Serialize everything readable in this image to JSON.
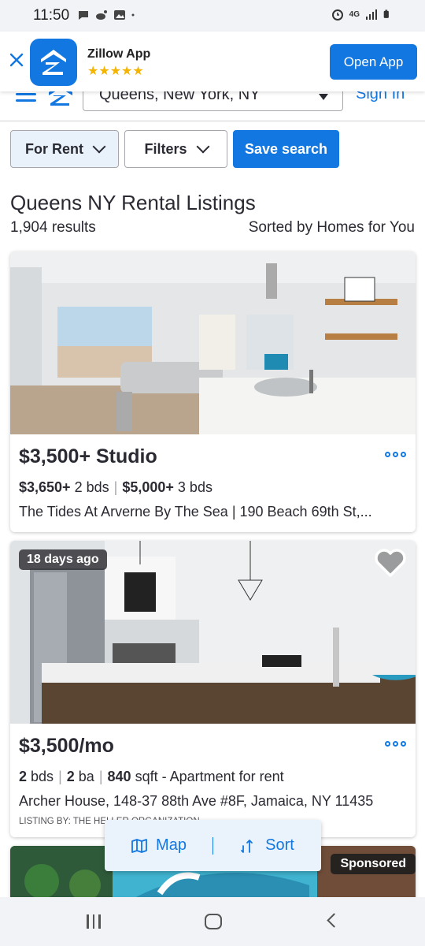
{
  "status_bar": {
    "time": "11:50",
    "network": "4G"
  },
  "app_banner": {
    "app_name": "Zillow App",
    "stars": "★★★★★",
    "open_button": "Open App"
  },
  "header": {
    "location": "Queens, New York, NY",
    "sign_in": "Sign In"
  },
  "filters": {
    "for_rent": "For Rent",
    "filters": "Filters",
    "save_search": "Save search"
  },
  "results": {
    "title": "Queens NY Rental Listings",
    "count": "1,904 results",
    "sorted_by": "Sorted by Homes for You"
  },
  "listings": [
    {
      "price": "$3,500+ Studio",
      "unit2_price": "$3,650+",
      "unit2_beds": "2 bds",
      "unit3_price": "$5,000+",
      "unit3_beds": "3 bds",
      "address": "The Tides At Arverne By The Sea | 190 Beach 69th St,..."
    },
    {
      "badge": "18 days ago",
      "price": "$3,500/mo",
      "beds_num": "2",
      "beds_unit": "bds",
      "baths_num": "2",
      "baths_unit": "ba",
      "sqft_num": "840",
      "sqft_unit": "sqft - Apartment for rent",
      "address": "Archer House, 148-37 88th Ave #8F, Jamaica, NY 11435",
      "listing_by": "LISTING BY: THE HELLER ORGANIZATION"
    },
    {
      "badge": "Sponsored"
    }
  ],
  "map_sort": {
    "map": "Map",
    "sort": "Sort"
  },
  "colors": {
    "brand_blue": "#1277e1",
    "text_dark": "#2a2a33"
  }
}
